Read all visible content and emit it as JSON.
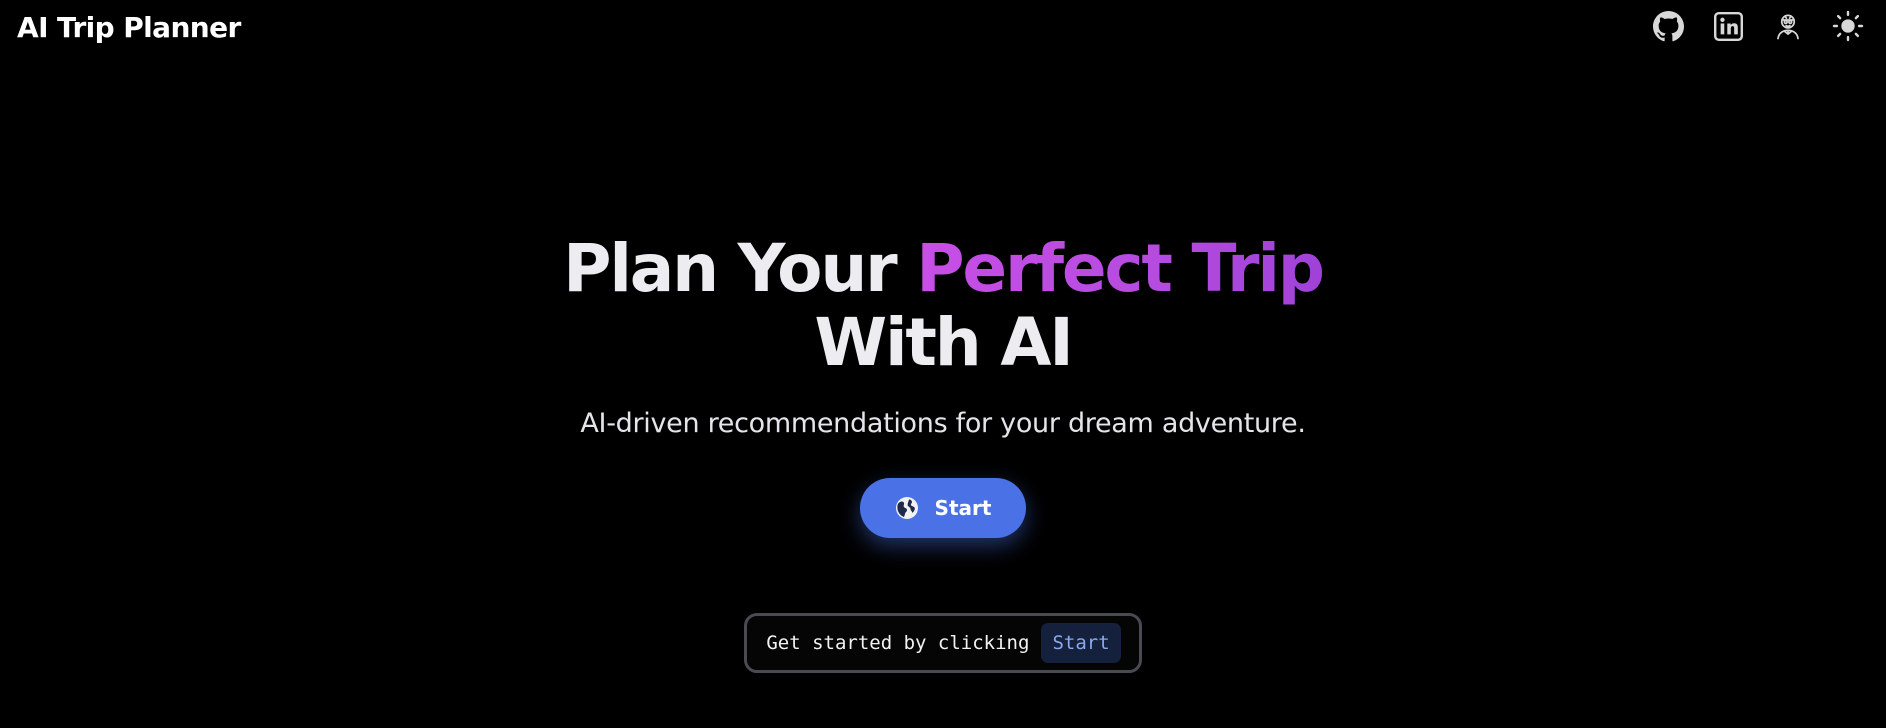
{
  "header": {
    "brand": "AI Trip Planner",
    "icons": [
      "github-icon",
      "linkedin-icon",
      "profile-icon",
      "sun-icon"
    ]
  },
  "hero": {
    "headline_part1": "Plan Your ",
    "headline_accent": "Perfect Trip",
    "headline_part2": "With AI",
    "subtitle": "AI-driven recommendations for your dream adventure.",
    "start_button_label": "Start",
    "start_button_icon": "globe-icon"
  },
  "hint": {
    "text": "Get started by clicking",
    "code": "Start"
  },
  "colors": {
    "background": "#000000",
    "accent_gradient": [
      "#c84ee6",
      "#9f42d8"
    ],
    "button": "#4a72e6",
    "hint_code_bg": "#15203d",
    "hint_code_text": "#8aa8f0"
  }
}
